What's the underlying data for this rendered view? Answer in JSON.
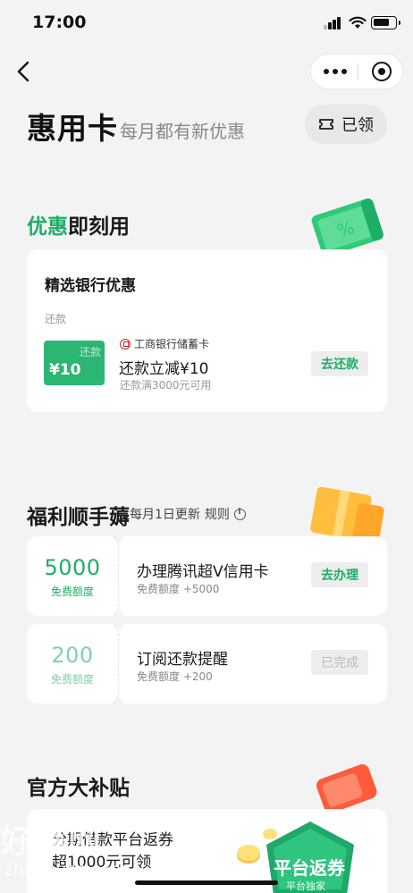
{
  "status_bar": {
    "time": "17:00"
  },
  "header": {
    "title": "惠用卡",
    "subtitle": "每月都有新优惠",
    "claimed_label": "已领"
  },
  "section_instant": {
    "title_accent": "优惠",
    "title_rest": "即刻用",
    "card": {
      "title": "精选银行优惠",
      "category": "还款",
      "coupon_tag": "还款",
      "coupon_amount": "¥10",
      "bank_name": "工商银行储蓄卡",
      "offer_title": "还款立减¥10",
      "offer_condition": "还款满3000元可用",
      "action_label": "去还款"
    }
  },
  "section_welfare": {
    "title": "福利顺手薅",
    "update_note": "每月1日更新",
    "rule_label": "规则",
    "tasks": [
      {
        "value": "5000",
        "value_label": "免费额度",
        "title": "办理腾讯超V信用卡",
        "reward": "免费额度 +5000",
        "action": "去办理",
        "done": false
      },
      {
        "value": "200",
        "value_label": "免费额度",
        "title": "订阅还款提醒",
        "reward": "免费额度 +200",
        "action": "已完成",
        "done": true
      }
    ]
  },
  "section_subsidy": {
    "title": "官方大补贴",
    "card_title": "分期借款平台返券",
    "card_subtitle": "超1000元可领",
    "badge_title": "平台返券",
    "badge_sub": "平台独家"
  },
  "watermark": {
    "text": "好赚网",
    "url": "zhuanyes.com"
  },
  "colors": {
    "accent": "#1fae66",
    "coupon": "#2bb673",
    "background": "#f3f3f3"
  }
}
